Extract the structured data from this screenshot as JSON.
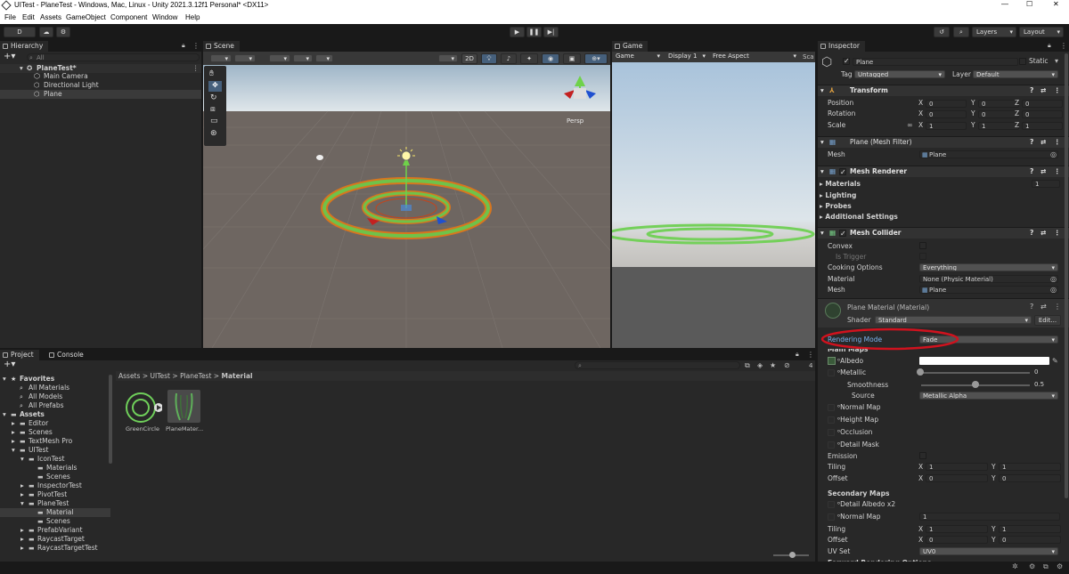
{
  "window": {
    "title": "UITest - PlaneTest - Windows, Mac, Linux - Unity 2021.3.12f1 Personal* <DX11>"
  },
  "menu": [
    "File",
    "Edit",
    "Assets",
    "GameObject",
    "Component",
    "Window",
    "Help"
  ],
  "toolbar": {
    "account": "D",
    "layers": "Layers",
    "layout": "Layout"
  },
  "hierarchy": {
    "tab": "Hierarchy",
    "search_placeholder": "All",
    "scene": "PlaneTest*",
    "items": [
      "Main Camera",
      "Directional Light",
      "Plane"
    ]
  },
  "scene": {
    "tab": "Scene",
    "mode2d": "2D",
    "persp": "Persp"
  },
  "game": {
    "tab": "Game",
    "view": "Game",
    "display": "Display 1",
    "aspect": "Free Aspect",
    "scale": "Sca"
  },
  "inspector": {
    "tab": "Inspector",
    "object_name": "Plane",
    "static_label": "Static",
    "tag_label": "Tag",
    "tag_value": "Untagged",
    "layer_label": "Layer",
    "layer_value": "Default",
    "transform": {
      "title": "Transform",
      "position_label": "Position",
      "rotation_label": "Rotation",
      "scale_label": "Scale",
      "position": [
        "0",
        "0",
        "0"
      ],
      "rotation": [
        "0",
        "0",
        "0"
      ],
      "scale": [
        "1",
        "1",
        "1"
      ],
      "axes": [
        "X",
        "Y",
        "Z"
      ]
    },
    "mesh_filter": {
      "title": "Plane (Mesh Filter)",
      "mesh_label": "Mesh",
      "mesh_value": "Plane"
    },
    "mesh_renderer": {
      "title": "Mesh Renderer",
      "materials": "Materials",
      "materials_count": "1",
      "lighting": "Lighting",
      "probes": "Probes",
      "additional": "Additional Settings"
    },
    "mesh_collider": {
      "title": "Mesh Collider",
      "convex": "Convex",
      "is_trigger": "Is Trigger",
      "cooking_label": "Cooking Options",
      "cooking_value": "Everything",
      "material_label": "Material",
      "material_value": "None (Physic Material)",
      "mesh_label": "Mesh",
      "mesh_value": "Plane"
    },
    "material": {
      "title": "Plane Material (Material)",
      "shader_label": "Shader",
      "shader_value": "Standard",
      "edit": "Edit...",
      "rendering_mode_label": "Rendering Mode",
      "rendering_mode_value": "Fade",
      "main_maps": "Main Maps",
      "albedo": "Albedo",
      "metallic": "Metallic",
      "metallic_value": "0",
      "smoothness": "Smoothness",
      "smoothness_value": "0.5",
      "source": "Source",
      "source_value": "Metallic Alpha",
      "normal_map": "Normal Map",
      "height_map": "Height Map",
      "occlusion": "Occlusion",
      "detail_mask": "Detail Mask",
      "emission": "Emission",
      "tiling": "Tiling",
      "tiling_x": "1",
      "tiling_y": "1",
      "offset": "Offset",
      "offset_x": "0",
      "offset_y": "0",
      "secondary_maps": "Secondary Maps",
      "detail_albedo": "Detail Albedo x2",
      "normal_map2": "Normal Map",
      "normal_map2_value": "1",
      "tiling2_x": "1",
      "tiling2_y": "1",
      "offset2_x": "0",
      "offset2_y": "0",
      "uv_set": "UV Set",
      "uv_set_value": "UV0",
      "forward": "Forward Rendering Options"
    },
    "highlight_color": "#d0121e"
  },
  "project": {
    "tabs": [
      "Project",
      "Console"
    ],
    "breadcrumb": [
      "Assets",
      "UITest",
      "PlaneTest",
      "Material"
    ],
    "count": "4",
    "tree": [
      {
        "label": "Favorites",
        "indent": 0,
        "bold": true,
        "icon": "star"
      },
      {
        "label": "All Materials",
        "indent": 1,
        "icon": "search"
      },
      {
        "label": "All Models",
        "indent": 1,
        "icon": "search"
      },
      {
        "label": "All Prefabs",
        "indent": 1,
        "icon": "search"
      },
      {
        "label": "Assets",
        "indent": 0,
        "bold": true,
        "icon": "folder"
      },
      {
        "label": "Editor",
        "indent": 1,
        "icon": "folder"
      },
      {
        "label": "Scenes",
        "indent": 1,
        "icon": "folder"
      },
      {
        "label": "TextMesh Pro",
        "indent": 1,
        "icon": "folder"
      },
      {
        "label": "UITest",
        "indent": 1,
        "icon": "folder"
      },
      {
        "label": "IconTest",
        "indent": 2,
        "icon": "folder"
      },
      {
        "label": "Materials",
        "indent": 3,
        "icon": "folder"
      },
      {
        "label": "Scenes",
        "indent": 3,
        "icon": "folder"
      },
      {
        "label": "InspectorTest",
        "indent": 2,
        "icon": "folder"
      },
      {
        "label": "PivotTest",
        "indent": 2,
        "icon": "folder"
      },
      {
        "label": "PlaneTest",
        "indent": 2,
        "icon": "folder"
      },
      {
        "label": "Material",
        "indent": 3,
        "icon": "folder",
        "selected": true
      },
      {
        "label": "Scenes",
        "indent": 3,
        "icon": "folder"
      },
      {
        "label": "PrefabVariant",
        "indent": 2,
        "icon": "folder"
      },
      {
        "label": "RaycastTarget",
        "indent": 2,
        "icon": "folder"
      },
      {
        "label": "RaycastTargetTest",
        "indent": 2,
        "icon": "folder"
      }
    ],
    "assets": [
      "GreenCircle",
      "PlaneMater..."
    ]
  }
}
